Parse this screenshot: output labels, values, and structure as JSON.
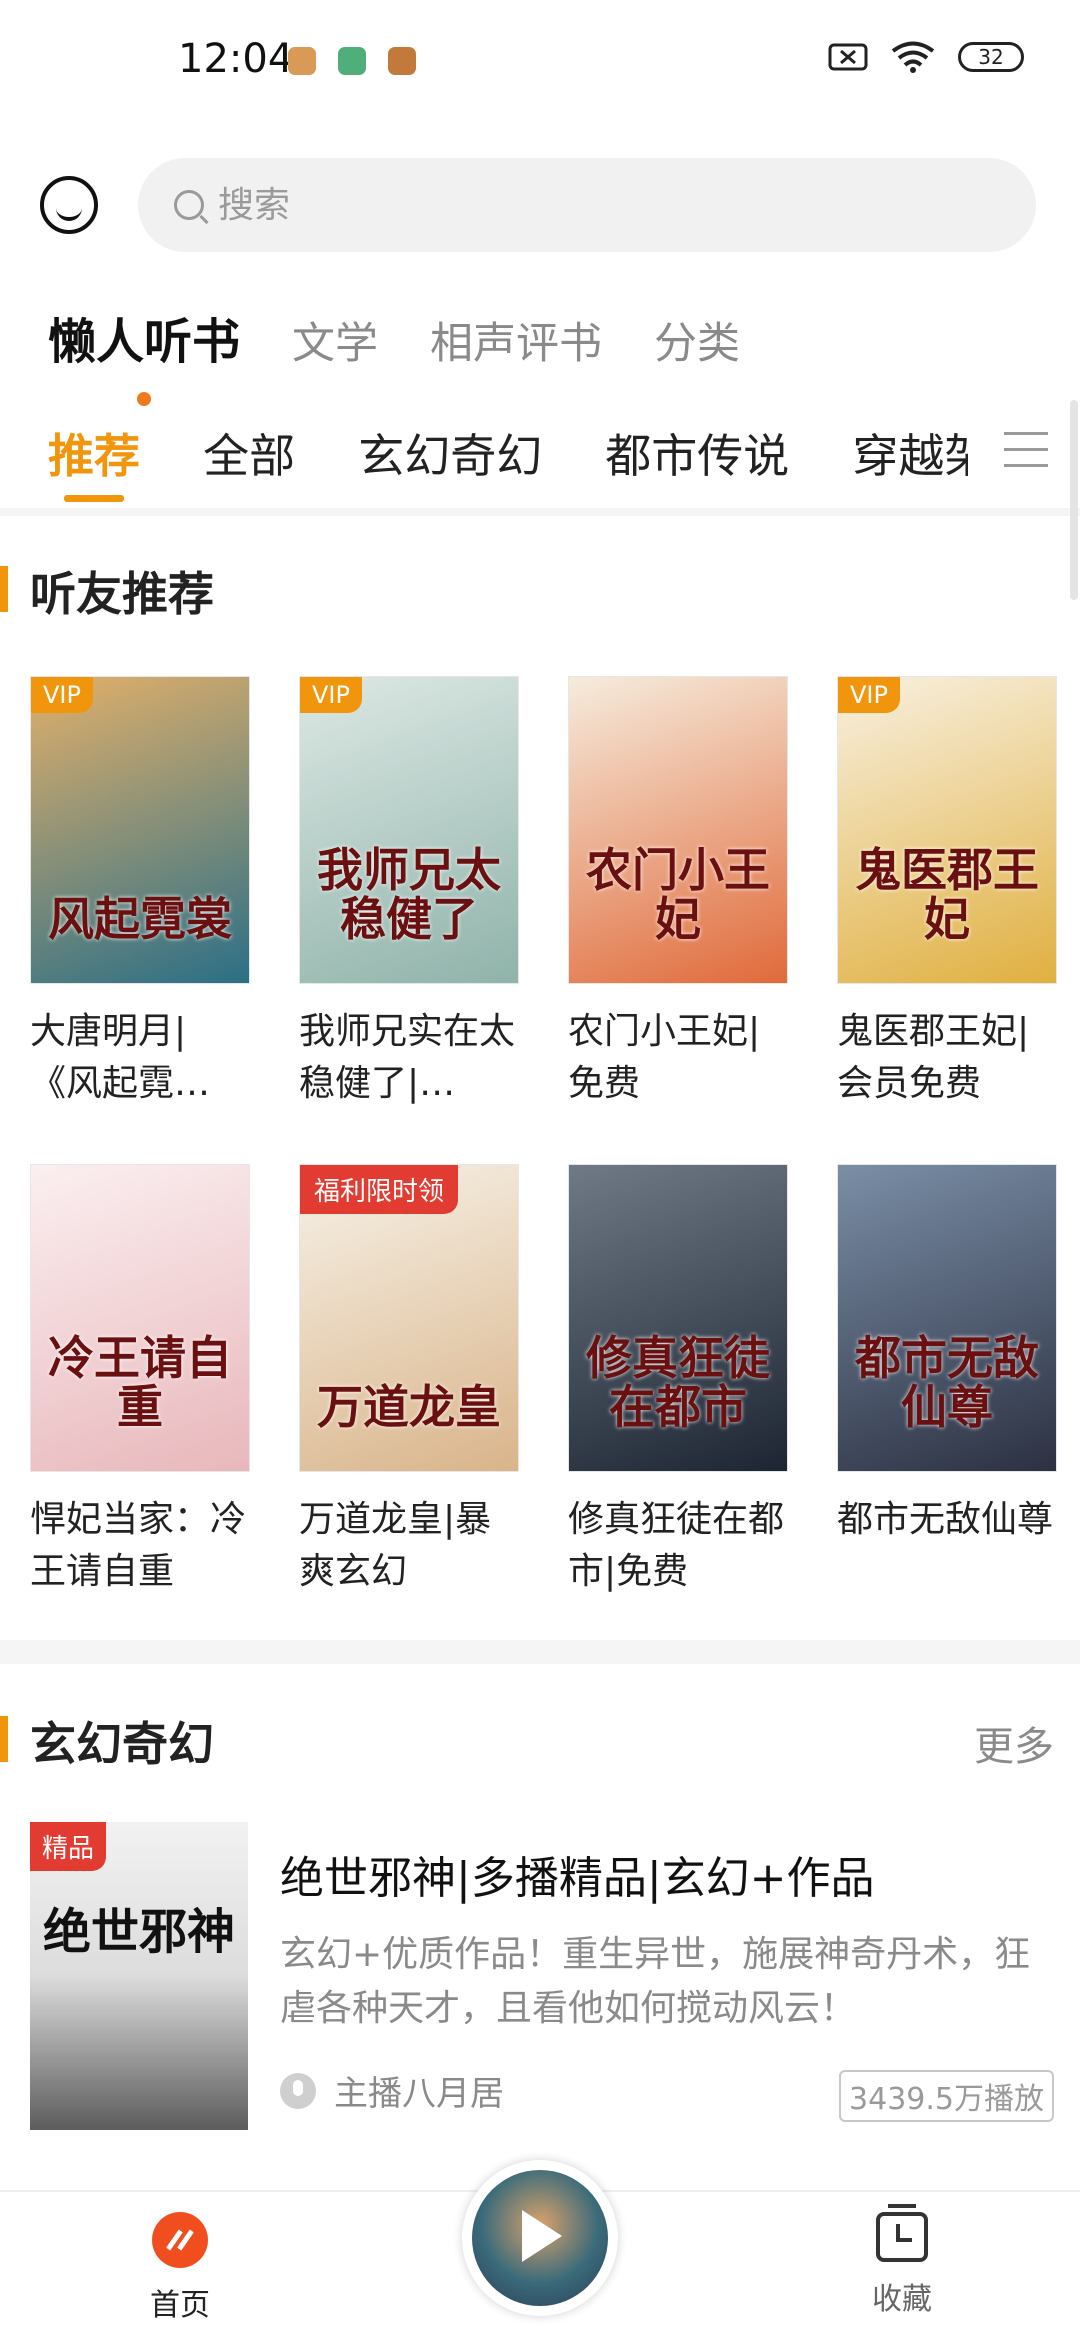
{
  "status_bar": {
    "time": "12:04",
    "battery": "32",
    "app_icon_colors": [
      "#d99a55",
      "#4fae7a",
      "#c27a3a"
    ]
  },
  "search": {
    "placeholder": "搜索"
  },
  "channels": [
    "懒人听书",
    "文学",
    "相声评书",
    "分类"
  ],
  "categories": [
    "推荐",
    "全部",
    "玄幻奇幻",
    "都市传说",
    "穿越架"
  ],
  "section_recommend": {
    "title": "听友推荐"
  },
  "books": [
    {
      "name": "大唐明月|《风起霓…",
      "tag": "VIP",
      "cover_text": "风起霓裳",
      "colors": [
        "#e2b06a",
        "#2b6f86"
      ]
    },
    {
      "name": "我师兄实在太稳健了|…",
      "tag": "VIP",
      "cover_text": "我师兄太稳健了",
      "colors": [
        "#dde8e4",
        "#8fb3aa"
      ]
    },
    {
      "name": "农门小王妃|免费",
      "tag": "",
      "cover_text": "农门小王妃",
      "colors": [
        "#f6ecdd",
        "#e06a3a"
      ]
    },
    {
      "name": "鬼医郡王妃|会员免费",
      "tag": "VIP",
      "cover_text": "鬼医郡王妃",
      "colors": [
        "#f8f0e0",
        "#e0b040"
      ]
    },
    {
      "name": "悍妃当家：冷王请自重",
      "tag": "",
      "cover_text": "冷王请自重",
      "colors": [
        "#fbeff0",
        "#e8b7bb"
      ]
    },
    {
      "name": "万道龙皇|暴爽玄幻",
      "tag": "福利限时领",
      "cover_text": "万道龙皇",
      "colors": [
        "#f7f2e8",
        "#d9b48a"
      ]
    },
    {
      "name": "修真狂徒在都市|免费",
      "tag": "",
      "cover_text": "修真狂徒在都市",
      "colors": [
        "#6f7a86",
        "#1d2533"
      ]
    },
    {
      "name": "都市无敌仙尊",
      "tag": "",
      "cover_text": "都市无敌仙尊",
      "colors": [
        "#7a8ea6",
        "#2c3142"
      ]
    }
  ],
  "section_fantasy": {
    "title": "玄幻奇幻",
    "more": "更多"
  },
  "feature": {
    "tag": "精品",
    "cover_text": "绝世邪神",
    "title": "绝世邪神|多播精品|玄幻+作品",
    "desc": "玄幻+优质作品！重生异世，施展神奇丹术，狂虐各种天才，且看他如何搅动风云！",
    "host": "主播八月居",
    "plays": "3439.5万播放"
  },
  "bottom_nav": {
    "home": "首页",
    "favorites": "收藏"
  },
  "accent": "#f0950c"
}
